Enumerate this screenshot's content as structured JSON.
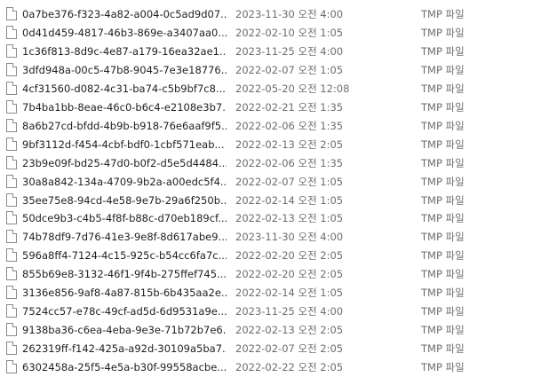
{
  "files": [
    {
      "name": "0a7be376-f323-4a82-a004-0c5ad9d07...",
      "modified": "2023-11-30 오전 4:00",
      "type": "TMP 파일"
    },
    {
      "name": "0d41d459-4817-46b3-869e-a3407aa0...",
      "modified": "2022-02-10 오전 1:05",
      "type": "TMP 파일"
    },
    {
      "name": "1c36f813-8d9c-4e87-a179-16ea32ae1...",
      "modified": "2023-11-25 오전 4:00",
      "type": "TMP 파일"
    },
    {
      "name": "3dfd948a-00c5-47b8-9045-7e3e18776...",
      "modified": "2022-02-07 오전 1:05",
      "type": "TMP 파일"
    },
    {
      "name": "4cf31560-d082-4c31-ba74-c5b9bf7c8...",
      "modified": "2022-05-20 오전 12:08",
      "type": "TMP 파일"
    },
    {
      "name": "7b4ba1bb-8eae-46c0-b6c4-e2108e3b7...",
      "modified": "2022-02-21 오전 1:35",
      "type": "TMP 파일"
    },
    {
      "name": "8a6b27cd-bfdd-4b9b-b918-76e6aaf9f5...",
      "modified": "2022-02-06 오전 1:35",
      "type": "TMP 파일"
    },
    {
      "name": "9bf3112d-f454-4cbf-bdf0-1cbf571eab...",
      "modified": "2022-02-13 오전 2:05",
      "type": "TMP 파일"
    },
    {
      "name": "23b9e09f-bd25-47d0-b0f2-d5e5d4484...",
      "modified": "2022-02-06 오전 1:35",
      "type": "TMP 파일"
    },
    {
      "name": "30a8a842-134a-4709-9b2a-a00edc5f4...",
      "modified": "2022-02-07 오전 1:05",
      "type": "TMP 파일"
    },
    {
      "name": "35ee75e8-94cd-4e58-9e7b-29a6f250b...",
      "modified": "2022-02-14 오전 1:05",
      "type": "TMP 파일"
    },
    {
      "name": "50dce9b3-c4b5-4f8f-b88c-d70eb189cf...",
      "modified": "2022-02-13 오전 1:05",
      "type": "TMP 파일"
    },
    {
      "name": "74b78df9-7d76-41e3-9e8f-8d617abe9...",
      "modified": "2023-11-30 오전 4:00",
      "type": "TMP 파일"
    },
    {
      "name": "596a8ff4-7124-4c15-925c-b54cc6fa7c...",
      "modified": "2022-02-20 오전 2:05",
      "type": "TMP 파일"
    },
    {
      "name": "855b69e8-3132-46f1-9f4b-275ffef745...",
      "modified": "2022-02-20 오전 2:05",
      "type": "TMP 파일"
    },
    {
      "name": "3136e856-9af8-4a87-815b-6b435aa2e...",
      "modified": "2022-02-14 오전 1:05",
      "type": "TMP 파일"
    },
    {
      "name": "7524cc57-e78c-49cf-ad5d-6d9531a9e...",
      "modified": "2023-11-25 오전 4:00",
      "type": "TMP 파일"
    },
    {
      "name": "9138ba36-c6ea-4eba-9e3e-71b72b7e6...",
      "modified": "2022-02-13 오전 2:05",
      "type": "TMP 파일"
    },
    {
      "name": "262319ff-f142-425a-a92d-30109a5ba7...",
      "modified": "2022-02-07 오전 2:05",
      "type": "TMP 파일"
    },
    {
      "name": "6302458a-25f5-4e5a-b30f-99558acbe...",
      "modified": "2022-02-22 오전 2:05",
      "type": "TMP 파일"
    }
  ],
  "icons": {
    "file": "tmp-file-icon"
  },
  "colors": {
    "name_text": "#1f1f1f",
    "meta_text": "#6d6d6d",
    "icon_border": "#8a8a8a",
    "background": "#ffffff"
  }
}
